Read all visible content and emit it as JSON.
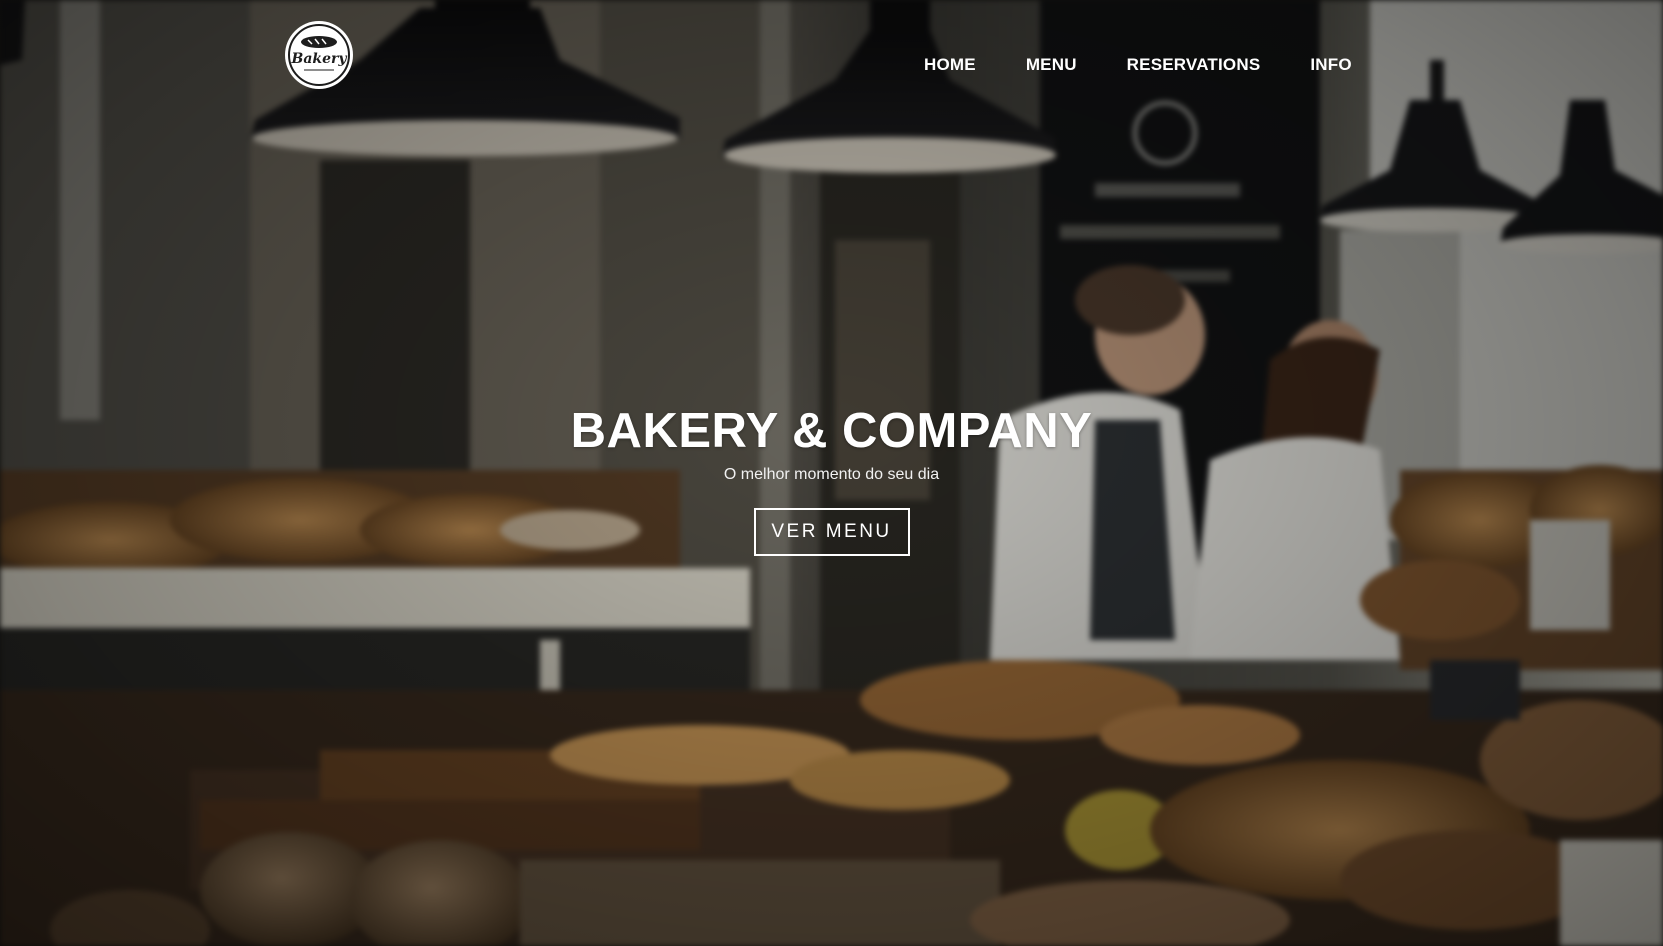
{
  "brand": {
    "logo_icon": "bakery-badge-logo",
    "logo_text": "Bakery"
  },
  "nav": {
    "items": [
      {
        "label": "HOME"
      },
      {
        "label": "MENU"
      },
      {
        "label": "RESERVATIONS"
      },
      {
        "label": "INFO"
      }
    ]
  },
  "hero": {
    "title": "BAKERY & COMPANY",
    "subtitle": "O melhor momento do seu dia",
    "cta_label": "VER MENU",
    "background_image": "blurred bakery counter photo"
  },
  "colors": {
    "text": "#ffffff",
    "overlay": "#000000",
    "warm_tone": "#b3824c"
  }
}
